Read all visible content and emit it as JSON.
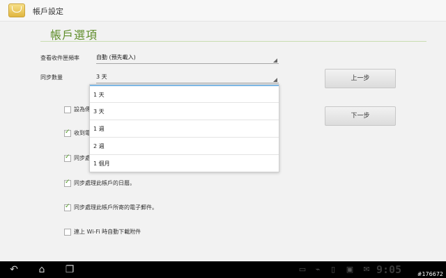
{
  "topbar": {
    "title": "帳戶設定",
    "icon": "email-icon"
  },
  "page": {
    "title": "帳戶選項"
  },
  "settings": {
    "check_frequency": {
      "label": "查看收件匣頻率",
      "value": "自動 (預先載入)"
    },
    "sync_amount": {
      "label": "同步數量",
      "value": "3 天"
    }
  },
  "buttons": {
    "previous": "上一步",
    "next": "下一步"
  },
  "dropdown": {
    "options": [
      "1 天",
      "3 天",
      "1 週",
      "2 週",
      "1 個月"
    ]
  },
  "checkboxes": [
    {
      "label": "設為傳",
      "checked": false
    },
    {
      "label": "收到電",
      "checked": true
    },
    {
      "label": "同步處",
      "checked": true
    },
    {
      "label": "同步處理此帳戶的日曆。",
      "checked": true
    },
    {
      "label": "同步處理此帳戶所寄的電子郵件。",
      "checked": true
    },
    {
      "label": "連上 Wi-Fi 時自動下載附件",
      "checked": false
    }
  ],
  "status": {
    "clock": "9:05"
  },
  "watermark": "#176672"
}
